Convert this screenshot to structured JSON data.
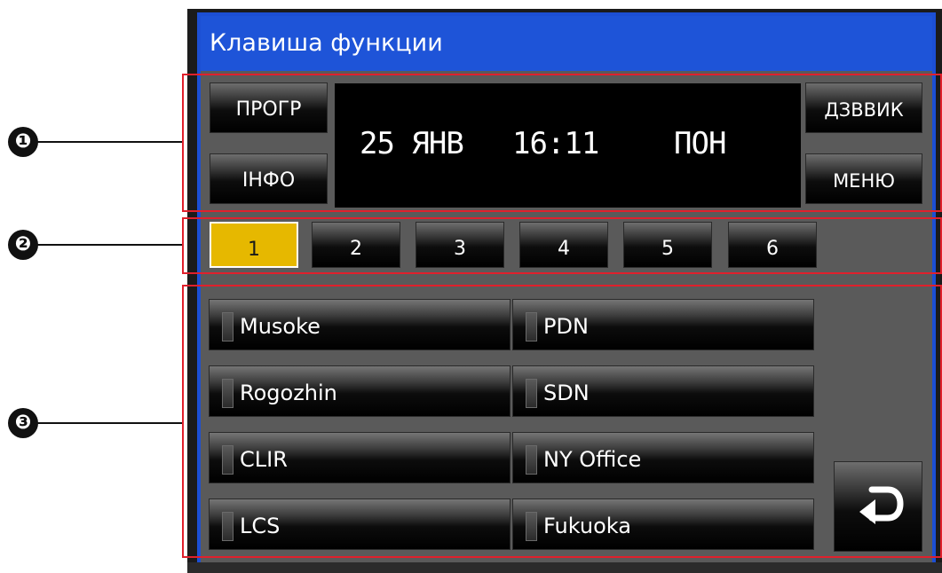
{
  "window": {
    "title": "Клавиша функции"
  },
  "callouts": [
    "❶",
    "❷",
    "❸"
  ],
  "header": {
    "progr_label": "ПРОГР",
    "info_label": "ІНФО",
    "ring_label": "ДЗВВИК",
    "menu_label": "МЕНЮ",
    "display": {
      "date": "25 ЯНВ",
      "time": "16:11",
      "day": "ПОН"
    }
  },
  "tabs": [
    {
      "label": "1",
      "active": true
    },
    {
      "label": "2",
      "active": false
    },
    {
      "label": "3",
      "active": false
    },
    {
      "label": "4",
      "active": false
    },
    {
      "label": "5",
      "active": false
    },
    {
      "label": "6",
      "active": false
    }
  ],
  "function_keys": [
    {
      "label": "Musoke"
    },
    {
      "label": "PDN"
    },
    {
      "label": "Rogozhin"
    },
    {
      "label": "SDN"
    },
    {
      "label": "CLIR"
    },
    {
      "label": "NY Office"
    },
    {
      "label": "LCS"
    },
    {
      "label": "Fukuoka"
    }
  ],
  "back_button": {
    "icon": "return-arrow-icon"
  },
  "colors": {
    "title_bar": "#1e54d8",
    "active_tab": "#e6b800",
    "annotation": "#e0202c"
  }
}
